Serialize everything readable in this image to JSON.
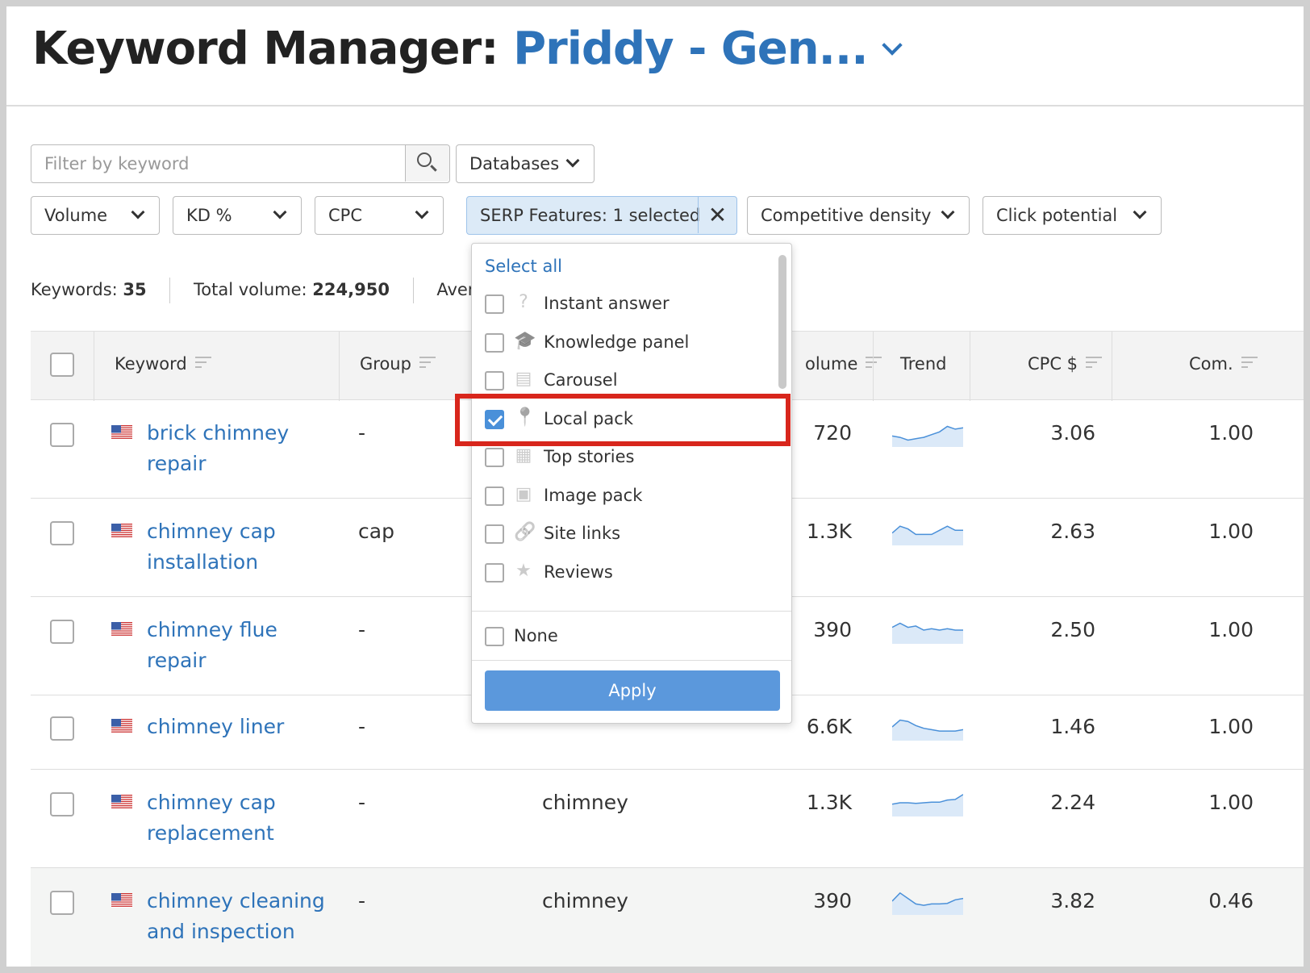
{
  "header": {
    "title_prefix": "Keyword Manager:",
    "project_name": "Priddy - Gen..."
  },
  "filters": {
    "search_placeholder": "Filter by keyword",
    "databases": "Databases",
    "volume": "Volume",
    "kd": "KD %",
    "cpc": "CPC",
    "serp_features": "SERP Features: 1 selected",
    "serp_clear": "✕",
    "competitive_density": "Competitive density",
    "click_potential": "Click potential"
  },
  "stats": {
    "keywords_label": "Keywords:",
    "keywords_value": "35",
    "total_volume_label": "Total volume:",
    "total_volume_value": "224,950",
    "average_label": "Average"
  },
  "table": {
    "headers": {
      "keyword": "Keyword",
      "group": "Group",
      "volume": "olume",
      "trend": "Trend",
      "cpc": "CPC $",
      "com": "Com."
    },
    "rows": [
      {
        "kw1": "brick chimney",
        "kw2": "repair",
        "group": "-",
        "topic": "",
        "volume": "720",
        "cpc": "3.06",
        "com": "1.00",
        "trend": [
          0.4,
          0.35,
          0.25,
          0.3,
          0.35,
          0.45,
          0.55,
          0.75,
          0.65,
          0.7
        ]
      },
      {
        "kw1": "chimney cap",
        "kw2": "installation",
        "group": "cap",
        "topic": "",
        "volume": "1.3K",
        "cpc": "2.63",
        "com": "1.00",
        "trend": [
          0.45,
          0.7,
          0.6,
          0.4,
          0.4,
          0.4,
          0.55,
          0.7,
          0.55,
          0.55
        ]
      },
      {
        "kw1": "chimney flue",
        "kw2": "repair",
        "group": "-",
        "topic": "",
        "volume": "390",
        "cpc": "2.50",
        "com": "1.00",
        "trend": [
          0.6,
          0.75,
          0.6,
          0.65,
          0.5,
          0.55,
          0.5,
          0.55,
          0.5,
          0.5
        ]
      },
      {
        "kw1": "chimney liner",
        "kw2": "",
        "group": "-",
        "topic": "",
        "volume": "6.6K",
        "cpc": "1.46",
        "com": "1.00",
        "trend": [
          0.5,
          0.75,
          0.7,
          0.55,
          0.45,
          0.4,
          0.35,
          0.35,
          0.35,
          0.4
        ]
      },
      {
        "kw1": "chimney cap",
        "kw2": "replacement",
        "group": "-",
        "topic": "chimney",
        "volume": "1.3K",
        "cpc": "2.24",
        "com": "1.00",
        "trend": [
          0.45,
          0.5,
          0.5,
          0.48,
          0.5,
          0.52,
          0.52,
          0.6,
          0.62,
          0.8
        ]
      },
      {
        "kw1": "chimney cleaning",
        "kw2": "and inspection",
        "group": "-",
        "topic": "chimney",
        "volume": "390",
        "cpc": "3.82",
        "com": "0.46",
        "trend": [
          0.5,
          0.8,
          0.6,
          0.4,
          0.35,
          0.4,
          0.4,
          0.42,
          0.55,
          0.6
        ]
      }
    ]
  },
  "serp_dropdown": {
    "select_all": "Select all",
    "options": [
      {
        "label": "Instant answer",
        "checked": false,
        "icon": "question-icon"
      },
      {
        "label": "Knowledge panel",
        "checked": false,
        "icon": "graduation-cap-icon"
      },
      {
        "label": "Carousel",
        "checked": false,
        "icon": "carousel-icon"
      },
      {
        "label": "Local pack",
        "checked": true,
        "icon": "map-pin-icon"
      },
      {
        "label": "Top stories",
        "checked": false,
        "icon": "newspaper-icon"
      },
      {
        "label": "Image pack",
        "checked": false,
        "icon": "image-icon"
      },
      {
        "label": "Site links",
        "checked": false,
        "icon": "link-icon"
      },
      {
        "label": "Reviews",
        "checked": false,
        "icon": "star-icon"
      }
    ],
    "none": "None",
    "apply": "Apply"
  },
  "colors": {
    "accent": "#2e73b9",
    "apply_button": "#5b98dc",
    "highlight": "#d8261c",
    "serp_active_bg": "#dceaf7",
    "trend_line": "#4a90d9",
    "trend_fill": "#dbe9f8"
  }
}
